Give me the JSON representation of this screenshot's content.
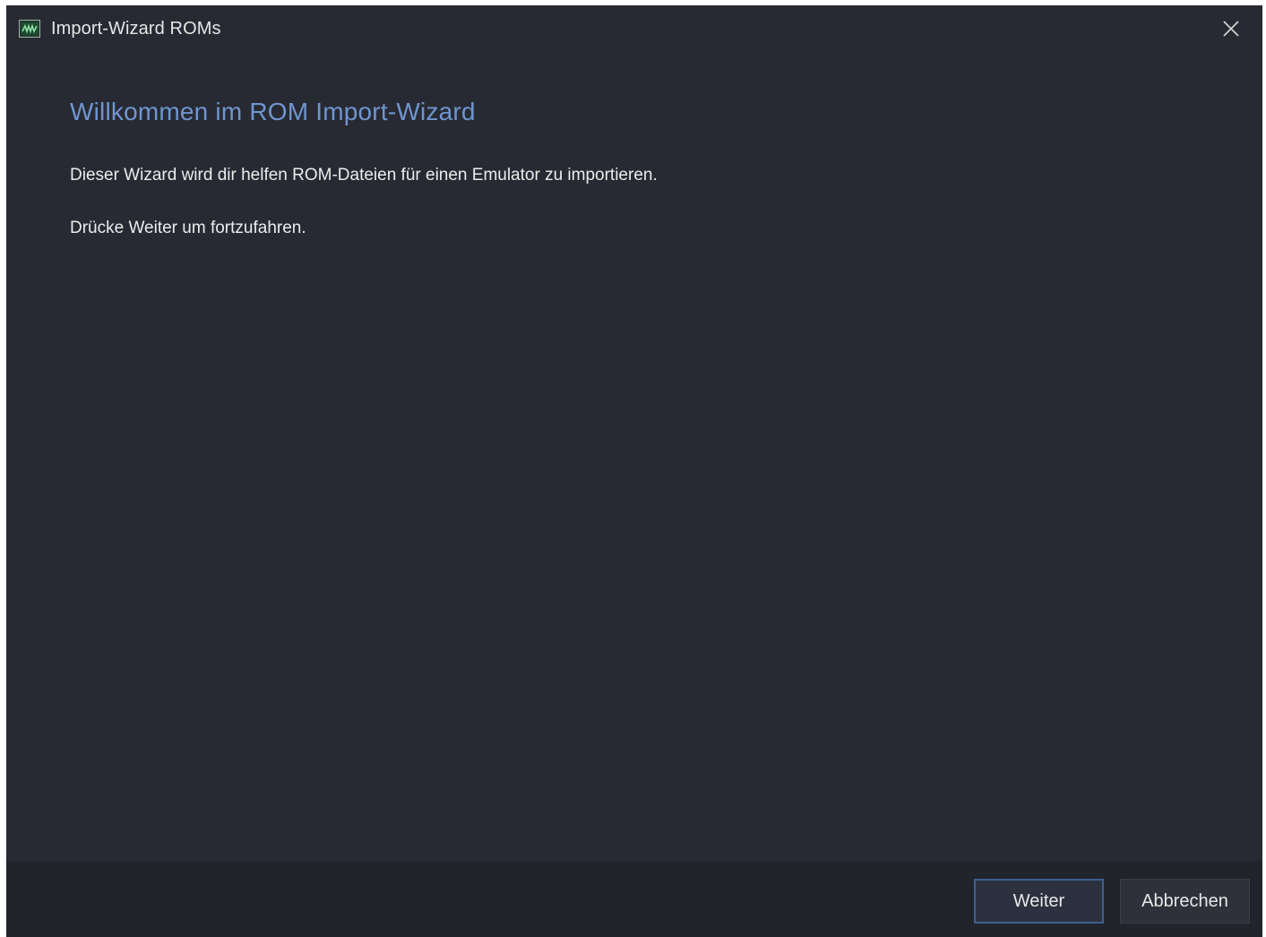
{
  "window": {
    "title": "Import-Wizard ROMs",
    "icon": "app-icon",
    "close_icon": "close-icon"
  },
  "content": {
    "heading": "Willkommen im ROM Import-Wizard",
    "paragraph_1": "Dieser Wizard wird dir helfen ROM-Dateien für einen Emulator zu importieren.",
    "paragraph_2": "Drücke Weiter um fortzufahren."
  },
  "footer": {
    "next_label": "Weiter",
    "cancel_label": "Abbrechen"
  },
  "colors": {
    "background": "#282a33",
    "footer_background": "#22242b",
    "heading": "#6f95cf",
    "text": "#ececec",
    "focus_border": "#3e5f8f"
  }
}
